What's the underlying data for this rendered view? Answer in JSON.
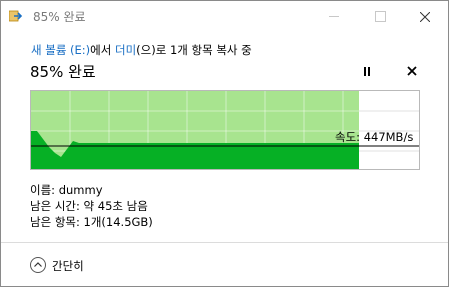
{
  "window": {
    "title": "85% 완료"
  },
  "copy_info": {
    "prefix": "",
    "source": "새 볼륨 (E:)",
    "from_word": "에서 ",
    "destination": "더미",
    "rest": "(으)로 1개 항목 복사 중"
  },
  "progress": {
    "title": "85% 완료",
    "percent": 85
  },
  "graph": {
    "speed_label": "속도: 447MB/s"
  },
  "details": {
    "name_label": "이름: ",
    "name_value": "dummy",
    "time_label": "남은 시간: ",
    "time_value": "약 45초 남음",
    "items_label": "남은 항목: ",
    "items_value": "1개(14.5GB)"
  },
  "footer": {
    "collapse_label": "간단히"
  },
  "colors": {
    "progress_light": "#a8e48f",
    "progress_dark": "#06b025",
    "link": "#1a6fc4"
  }
}
